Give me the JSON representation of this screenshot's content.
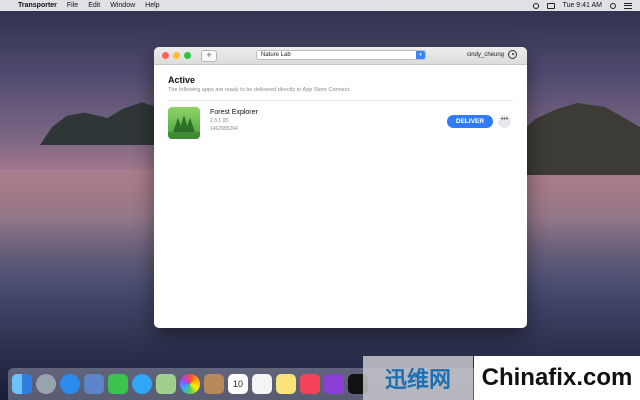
{
  "menubar": {
    "apple": "",
    "app_name": "Transporter",
    "items": [
      "File",
      "Edit",
      "Window",
      "Help"
    ],
    "clock": "Tue 9:41 AM"
  },
  "window": {
    "add_button": "+",
    "team": "Nature Lab",
    "account": "cindy_cheung",
    "section_title": "Active",
    "section_subtitle": "The following apps are ready to be delivered directly to App Store Connect.",
    "apps": [
      {
        "name": "Forest Explorer",
        "version": "2.3.1 (8)",
        "id": "1462985264",
        "action": "DELIVER",
        "more": "•••"
      }
    ]
  },
  "dock": {
    "icons": [
      "finder-icon",
      "launchpad-icon",
      "safari-icon",
      "preview-icon",
      "facetime-icon",
      "messages-icon",
      "maps-icon",
      "photos-icon",
      "contacts-icon",
      "calendar-icon",
      "reminders-icon",
      "notes-icon",
      "music-icon",
      "podcasts-icon",
      "tv-icon"
    ],
    "calendar_day": "10"
  },
  "watermarks": {
    "left": "迅维网",
    "right": "Chinafix.com"
  }
}
